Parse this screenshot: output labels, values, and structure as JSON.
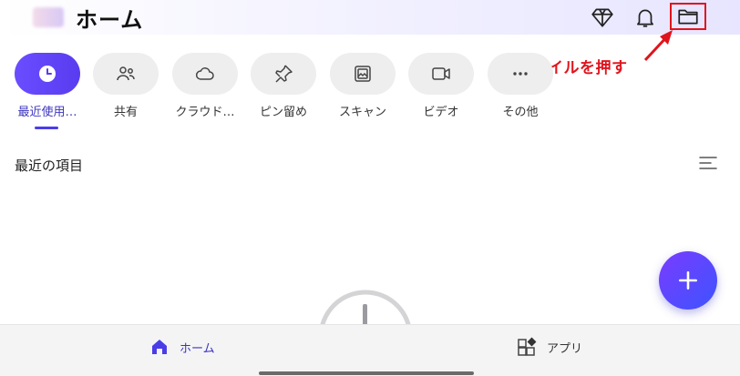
{
  "header": {
    "title": "ホーム",
    "icons": [
      "diamond-icon",
      "bell-icon",
      "folder-icon"
    ]
  },
  "annotation": {
    "text": "ファイルを押す",
    "color": "#e0141c"
  },
  "categories": [
    {
      "label": "最近使用…",
      "icon": "clock-icon",
      "active": true
    },
    {
      "label": "共有",
      "icon": "people-icon",
      "active": false
    },
    {
      "label": "クラウド…",
      "icon": "cloud-icon",
      "active": false
    },
    {
      "label": "ピン留め",
      "icon": "pin-icon",
      "active": false
    },
    {
      "label": "スキャン",
      "icon": "scan-icon",
      "active": false
    },
    {
      "label": "ビデオ",
      "icon": "video-icon",
      "active": false
    },
    {
      "label": "その他",
      "icon": "more-icon",
      "active": false
    }
  ],
  "section": {
    "title": "最近の項目"
  },
  "fab": {
    "icon": "plus-icon"
  },
  "bottom_nav": [
    {
      "label": "ホーム",
      "icon": "home-icon",
      "active": true
    },
    {
      "label": "アプリ",
      "icon": "apps-icon",
      "active": false
    }
  ],
  "colors": {
    "accent": "#4a3de8",
    "annotation_red": "#e0141c"
  }
}
